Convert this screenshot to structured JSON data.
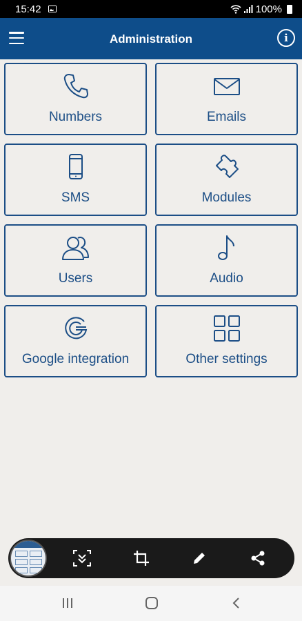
{
  "status_bar": {
    "time": "15:42",
    "battery": "100%"
  },
  "app_bar": {
    "title": "Administration",
    "info_glyph": "i"
  },
  "tiles": [
    {
      "label": "Numbers",
      "icon": "phone-icon"
    },
    {
      "label": "Emails",
      "icon": "envelope-icon"
    },
    {
      "label": "SMS",
      "icon": "mobile-icon"
    },
    {
      "label": "Modules",
      "icon": "puzzle-icon"
    },
    {
      "label": "Users",
      "icon": "users-icon"
    },
    {
      "label": "Audio",
      "icon": "music-note-icon"
    },
    {
      "label": "Google integration",
      "icon": "google-icon"
    },
    {
      "label": "Other settings",
      "icon": "grid-icon"
    }
  ],
  "colors": {
    "primary": "#0e4d8a",
    "tile_border": "#1c4e86",
    "background": "#f0eeeb"
  },
  "capture_toolbar": {
    "tools": [
      "scroll-capture-icon",
      "crop-icon",
      "pen-icon",
      "share-icon"
    ]
  },
  "nav_bar": {
    "buttons": [
      "recents-icon",
      "home-icon",
      "back-icon"
    ]
  }
}
